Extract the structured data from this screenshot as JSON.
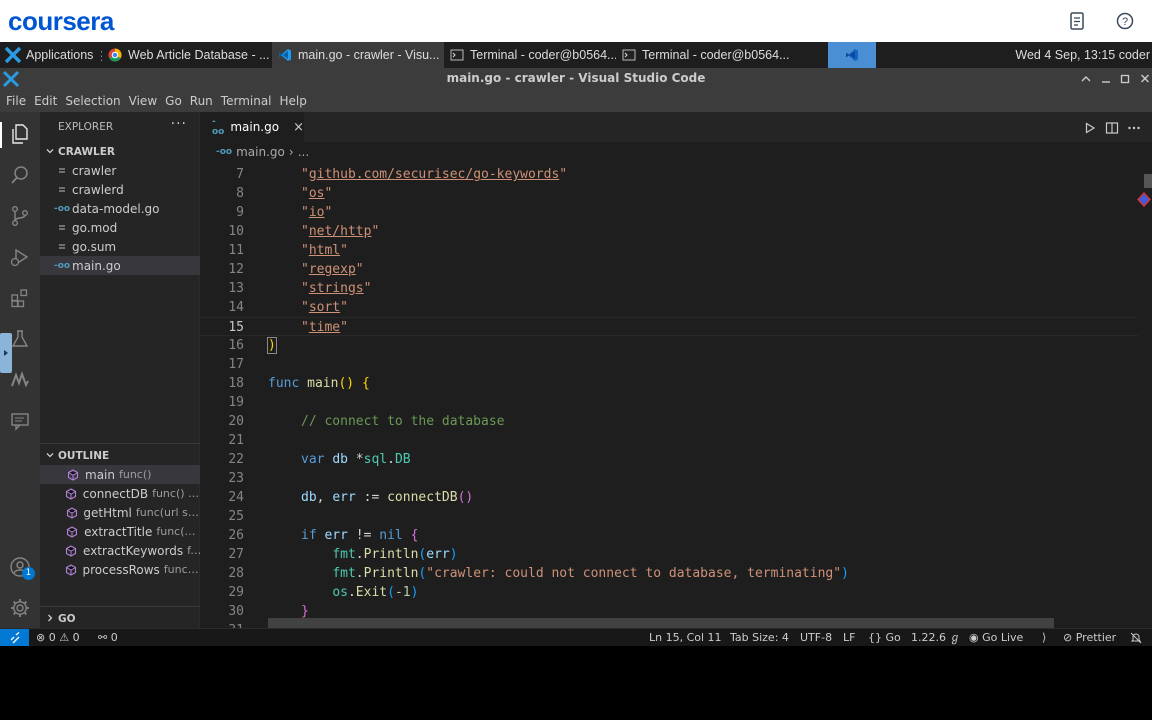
{
  "coursera": {
    "logo": "coursera"
  },
  "taskbar": {
    "applications": "Applications",
    "tasks": [
      {
        "label": "Web Article Database - ...",
        "icon": "chrome-icon"
      },
      {
        "label": "main.go - crawler - Visu...",
        "icon": "vscode-icon"
      },
      {
        "label": "Terminal - coder@b0564...",
        "icon": "terminal-icon"
      },
      {
        "label": "Terminal - coder@b0564...",
        "icon": "terminal-icon"
      }
    ],
    "clock": "Wed  4 Sep, 13:15 coder"
  },
  "window": {
    "title": "main.go - crawler - Visual Studio Code"
  },
  "menu": [
    "File",
    "Edit",
    "Selection",
    "View",
    "Go",
    "Run",
    "Terminal",
    "Help"
  ],
  "explorer": {
    "header": "EXPLORER",
    "more": "···",
    "folder": "CRAWLER",
    "files": [
      {
        "name": "crawler",
        "type": "binary"
      },
      {
        "name": "crawlerd",
        "type": "binary"
      },
      {
        "name": "data-model.go",
        "type": "go"
      },
      {
        "name": "go.mod",
        "type": "binary"
      },
      {
        "name": "go.sum",
        "type": "binary"
      },
      {
        "name": "main.go",
        "type": "go",
        "selected": true
      }
    ],
    "go_badge": "-oo"
  },
  "outline": {
    "header": "OUTLINE",
    "items": [
      {
        "name": "main",
        "detail": "func()"
      },
      {
        "name": "connectDB",
        "detail": "func() (..."
      },
      {
        "name": "getHtml",
        "detail": "func(url st..."
      },
      {
        "name": "extractTitle",
        "detail": "func(c..."
      },
      {
        "name": "extractKeywords",
        "detail": "f..."
      },
      {
        "name": "processRows",
        "detail": "func(..."
      }
    ]
  },
  "go_section": {
    "header": "GO"
  },
  "activity": {
    "accounts_badge": "1"
  },
  "editor": {
    "tab": {
      "label": "main.go",
      "close": "×"
    },
    "breadcrumb": {
      "file": "main.go",
      "sep": "›",
      "rest": "..."
    },
    "lines": [
      {
        "n": "7",
        "tokens": [
          [
            "s",
            "\""
          ],
          [
            "u",
            "github.com/securisec/go-keywords"
          ],
          [
            "s",
            "\""
          ]
        ]
      },
      {
        "n": "8",
        "tokens": [
          [
            "s",
            "\""
          ],
          [
            "u",
            "os"
          ],
          [
            "s",
            "\""
          ]
        ]
      },
      {
        "n": "9",
        "tokens": [
          [
            "s",
            "\""
          ],
          [
            "u",
            "io"
          ],
          [
            "s",
            "\""
          ]
        ]
      },
      {
        "n": "10",
        "tokens": [
          [
            "s",
            "\""
          ],
          [
            "u",
            "net/http"
          ],
          [
            "s",
            "\""
          ]
        ]
      },
      {
        "n": "11",
        "tokens": [
          [
            "s",
            "\""
          ],
          [
            "u",
            "html"
          ],
          [
            "s",
            "\""
          ]
        ]
      },
      {
        "n": "12",
        "tokens": [
          [
            "s",
            "\""
          ],
          [
            "u",
            "regexp"
          ],
          [
            "s",
            "\""
          ]
        ]
      },
      {
        "n": "13",
        "tokens": [
          [
            "s",
            "\""
          ],
          [
            "u",
            "strings"
          ],
          [
            "s",
            "\""
          ]
        ]
      },
      {
        "n": "14",
        "tokens": [
          [
            "s",
            "\""
          ],
          [
            "u",
            "sort"
          ],
          [
            "s",
            "\""
          ]
        ]
      },
      {
        "n": "15",
        "tokens": [
          [
            "s",
            "\""
          ],
          [
            "u",
            "time"
          ],
          [
            "s",
            "\""
          ]
        ],
        "current": true
      },
      {
        "n": "16",
        "tokens": [
          [
            "bh",
            ")"
          ]
        ],
        "flush": true
      },
      {
        "n": "17",
        "tokens": []
      },
      {
        "n": "18",
        "tokens": [
          [
            "k",
            "func"
          ],
          [
            "p",
            " "
          ],
          [
            "fn",
            "main"
          ],
          [
            "b1",
            "()"
          ],
          [
            "p",
            " "
          ],
          [
            "b1",
            "{"
          ]
        ],
        "flush": true
      },
      {
        "n": "19",
        "tokens": []
      },
      {
        "n": "20",
        "tokens": [
          [
            "c",
            "// connect to the database"
          ]
        ]
      },
      {
        "n": "21",
        "tokens": []
      },
      {
        "n": "22",
        "tokens": [
          [
            "k",
            "var"
          ],
          [
            "p",
            " "
          ],
          [
            "v",
            "db"
          ],
          [
            "p",
            " *"
          ],
          [
            "t",
            "sql"
          ],
          [
            "p",
            "."
          ],
          [
            "t",
            "DB"
          ]
        ]
      },
      {
        "n": "23",
        "tokens": []
      },
      {
        "n": "24",
        "tokens": [
          [
            "v",
            "db"
          ],
          [
            "p",
            ", "
          ],
          [
            "v",
            "err"
          ],
          [
            "p",
            " := "
          ],
          [
            "fn",
            "connectDB"
          ],
          [
            "b2",
            "()"
          ]
        ]
      },
      {
        "n": "25",
        "tokens": []
      },
      {
        "n": "26",
        "tokens": [
          [
            "k",
            "if"
          ],
          [
            "p",
            " "
          ],
          [
            "v",
            "err"
          ],
          [
            "p",
            " != "
          ],
          [
            "k",
            "nil"
          ],
          [
            "p",
            " "
          ],
          [
            "b2",
            "{"
          ]
        ]
      },
      {
        "n": "27",
        "tokens": [
          [
            "p",
            "    "
          ],
          [
            "t",
            "fmt"
          ],
          [
            "p",
            "."
          ],
          [
            "fn",
            "Println"
          ],
          [
            "b3",
            "("
          ],
          [
            "v",
            "err"
          ],
          [
            "b3",
            ")"
          ]
        ]
      },
      {
        "n": "28",
        "tokens": [
          [
            "p",
            "    "
          ],
          [
            "t",
            "fmt"
          ],
          [
            "p",
            "."
          ],
          [
            "fn",
            "Println"
          ],
          [
            "b3",
            "("
          ],
          [
            "s",
            "\"crawler: could not connect to database, terminating\""
          ],
          [
            "b3",
            ")"
          ]
        ]
      },
      {
        "n": "29",
        "tokens": [
          [
            "p",
            "    "
          ],
          [
            "t",
            "os"
          ],
          [
            "p",
            "."
          ],
          [
            "fn",
            "Exit"
          ],
          [
            "b3",
            "("
          ],
          [
            "n",
            "-1"
          ],
          [
            "b3",
            ")"
          ]
        ]
      },
      {
        "n": "30",
        "tokens": [
          [
            "b2",
            "}"
          ]
        ]
      },
      {
        "n": "31",
        "tokens": []
      }
    ]
  },
  "status": {
    "errors": "0",
    "warnings": "0",
    "ports": "0",
    "position": "Ln 15, Col 11",
    "tab_size": "Tab Size: 4",
    "encoding": "UTF-8",
    "eol": "LF",
    "language": "Go",
    "go_version": "1.22.6",
    "live": "Go Live",
    "prettier": "Prettier"
  },
  "colors": {
    "coursera_blue": "#0056d2",
    "vscode_blue": "#0078d4",
    "editor_bg": "#1e1e1e",
    "sidebar_bg": "#252526"
  }
}
